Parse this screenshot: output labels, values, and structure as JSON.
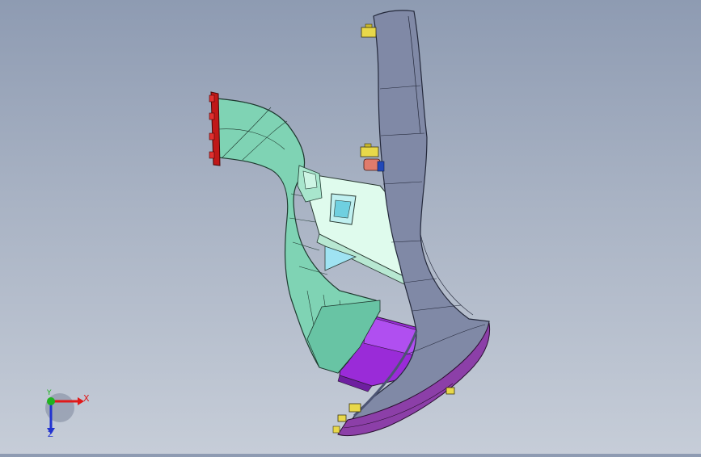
{
  "viewport": {
    "background_top": "#8e9bb2",
    "background_bottom": "#c6cdd8"
  },
  "model": {
    "colors": {
      "duct": "#7fd3b4",
      "duct_dark": "#5fb596",
      "flange": "#c01818",
      "bracket": "#d9fbe9",
      "pillar": "#8089a6",
      "pillar_dark": "#4d5574",
      "motor": "#9a2bd8",
      "base_trim": "#8c3fa8",
      "bolt": "#e8d84a",
      "connector_red": "#e07b6c",
      "connector_blue": "#2248b8"
    }
  },
  "triad": {
    "x_label": "X",
    "y_label": "Y",
    "z_label": "Z",
    "x_color": "#e01919",
    "y_color": "#1fb31f",
    "z_color": "#2233d0"
  }
}
